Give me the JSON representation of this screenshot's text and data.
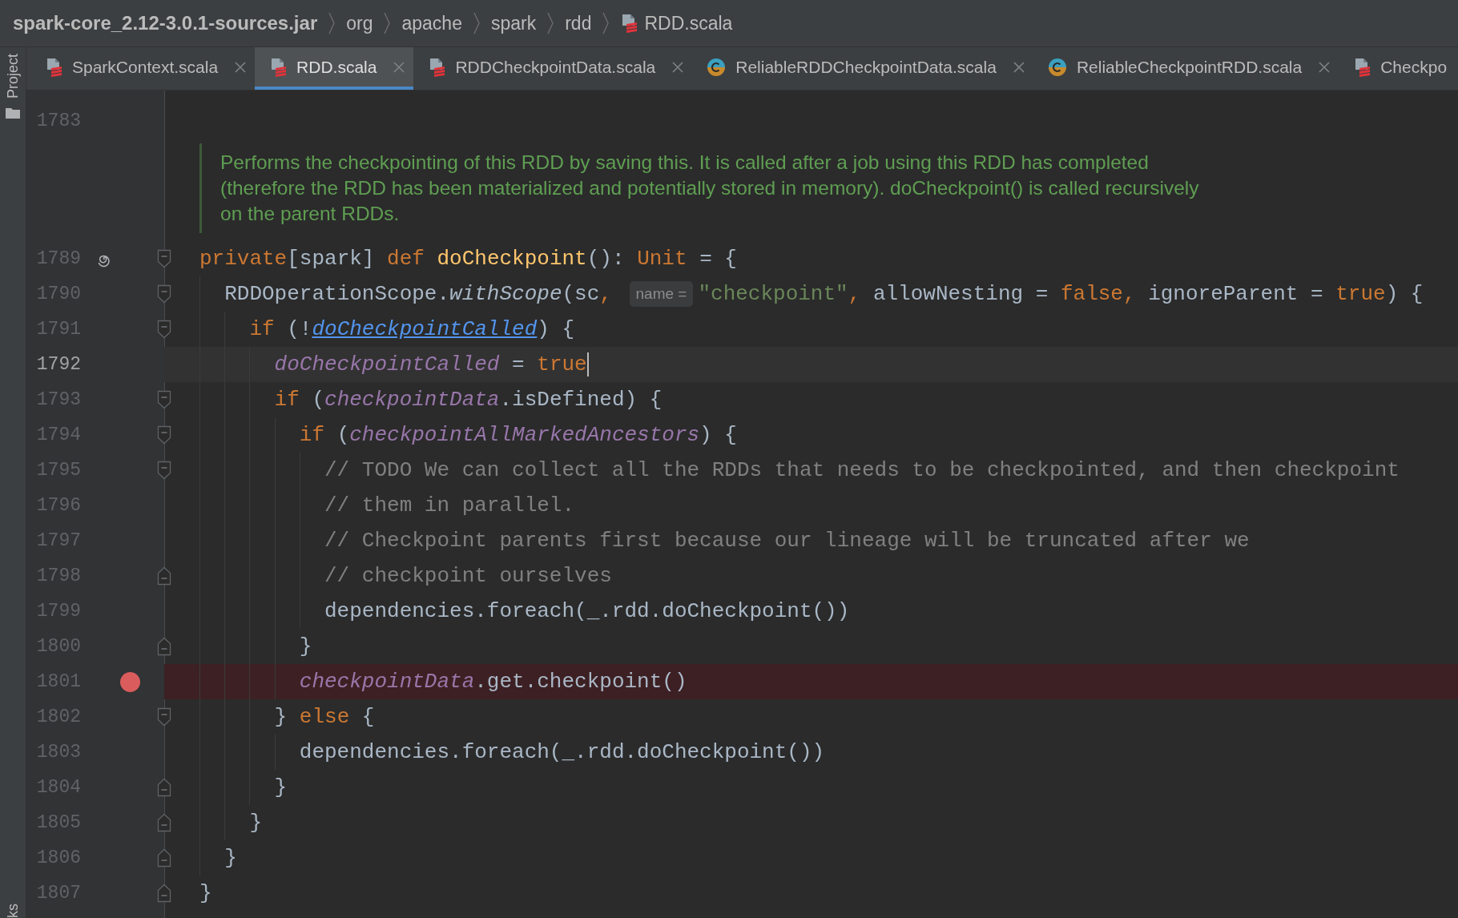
{
  "breadcrumbs": [
    {
      "label": "spark-core_2.12-3.0.1-sources.jar",
      "kind": "archive"
    },
    {
      "label": "org",
      "kind": "package"
    },
    {
      "label": "apache",
      "kind": "package"
    },
    {
      "label": "spark",
      "kind": "package"
    },
    {
      "label": "rdd",
      "kind": "package"
    },
    {
      "label": "RDD.scala",
      "kind": "scala_file"
    }
  ],
  "tool_strip": [
    {
      "label": "Project",
      "kind": "project"
    },
    {
      "label": "ks",
      "kind": "bookmarks"
    }
  ],
  "tabs": [
    {
      "label": "SparkContext.scala",
      "kind": "scala_file",
      "selected": false,
      "closable": true
    },
    {
      "label": "RDD.scala",
      "kind": "scala_file",
      "selected": true,
      "closable": true
    },
    {
      "label": "RDDCheckpointData.scala",
      "kind": "scala_file",
      "selected": false,
      "closable": true
    },
    {
      "label": "ReliableRDDCheckpointData.scala",
      "kind": "class",
      "selected": false,
      "closable": true
    },
    {
      "label": "ReliableCheckpointRDD.scala",
      "kind": "class",
      "selected": false,
      "closable": true
    },
    {
      "label": "Checkpo",
      "kind": "scala_file",
      "selected": false,
      "closable": false
    }
  ],
  "editor": {
    "lines": [
      {
        "kind": "code",
        "number": "1783",
        "recursion_marker": false,
        "breakpoint": false,
        "current": false,
        "caret": false
      },
      {
        "kind": "doc",
        "lines": [
          "Performs the checkpointing of this RDD by saving this. It is called after a job using this RDD has completed",
          "(therefore the RDD has been materialized and potentially stored in memory). doCheckpoint() is called recursively",
          "on the parent RDDs."
        ]
      },
      {
        "kind": "fold_start",
        "number": "1789",
        "recursion_marker": true,
        "breakpoint": false,
        "current": false,
        "caret": false,
        "tokens": [
          {
            "kind": "keyword",
            "text": "private"
          },
          {
            "kind": "plain",
            "text": "[spark] "
          },
          {
            "kind": "keyword",
            "text": "def "
          },
          {
            "kind": "declaration",
            "text": "doCheckpoint"
          },
          {
            "kind": "plain",
            "text": "(): "
          },
          {
            "kind": "keyword",
            "text": "Unit"
          },
          {
            "kind": "plain",
            "text": " = {"
          }
        ]
      },
      {
        "kind": "fold_start",
        "number": "1790",
        "recursion_marker": false,
        "breakpoint": false,
        "current": false,
        "caret": false,
        "tokens": [
          {
            "kind": "plain",
            "text": "  RDDOperationScope."
          },
          {
            "kind": "call",
            "text": "withScope"
          },
          {
            "kind": "plain",
            "text": "(sc"
          },
          {
            "kind": "keyword",
            "text": ", "
          },
          {
            "kind": "hint",
            "text": "name ="
          },
          {
            "kind": "string",
            "text": "\"checkpoint\""
          },
          {
            "kind": "keyword",
            "text": ", "
          },
          {
            "kind": "plain",
            "text": "allowNesting = "
          },
          {
            "kind": "keyword",
            "text": "false, "
          },
          {
            "kind": "plain",
            "text": "ignoreParent = "
          },
          {
            "kind": "keyword",
            "text": "true"
          },
          {
            "kind": "plain",
            "text": ") {"
          }
        ]
      },
      {
        "kind": "fold_start",
        "number": "1791",
        "recursion_marker": false,
        "breakpoint": false,
        "current": false,
        "caret": false,
        "tokens": [
          {
            "kind": "keyword",
            "text": "    if "
          },
          {
            "kind": "plain",
            "text": "(!"
          },
          {
            "kind": "link",
            "text": "doCheckpointCalled"
          },
          {
            "kind": "plain",
            "text": ") {"
          }
        ]
      },
      {
        "kind": "code",
        "number": "1792",
        "recursion_marker": false,
        "breakpoint": false,
        "current": true,
        "caret": true,
        "tokens": [
          {
            "kind": "field",
            "text": "      doCheckpointCalled"
          },
          {
            "kind": "plain",
            "text": " = "
          },
          {
            "kind": "keyword",
            "text": "true"
          }
        ]
      },
      {
        "kind": "fold_start",
        "number": "1793",
        "recursion_marker": false,
        "breakpoint": false,
        "current": false,
        "caret": false,
        "tokens": [
          {
            "kind": "keyword",
            "text": "      if "
          },
          {
            "kind": "plain",
            "text": "("
          },
          {
            "kind": "field",
            "text": "checkpointData"
          },
          {
            "kind": "plain",
            "text": ".isDefined) {"
          }
        ]
      },
      {
        "kind": "fold_start",
        "number": "1794",
        "recursion_marker": false,
        "breakpoint": false,
        "current": false,
        "caret": false,
        "tokens": [
          {
            "kind": "keyword",
            "text": "        if "
          },
          {
            "kind": "plain",
            "text": "("
          },
          {
            "kind": "field",
            "text": "checkpointAllMarkedAncestors"
          },
          {
            "kind": "plain",
            "text": ") {"
          }
        ]
      },
      {
        "kind": "fold_start",
        "number": "1795",
        "recursion_marker": false,
        "breakpoint": false,
        "current": false,
        "caret": false,
        "tokens": [
          {
            "kind": "comment",
            "text": "          // TODO We can collect all the RDDs that needs to be checkpointed, and then checkpoint"
          }
        ]
      },
      {
        "kind": "code",
        "number": "1796",
        "recursion_marker": false,
        "breakpoint": false,
        "current": false,
        "caret": false,
        "tokens": [
          {
            "kind": "comment",
            "text": "          // them in parallel."
          }
        ]
      },
      {
        "kind": "code",
        "number": "1797",
        "recursion_marker": false,
        "breakpoint": false,
        "current": false,
        "caret": false,
        "tokens": [
          {
            "kind": "comment",
            "text": "          // Checkpoint parents first because our lineage will be truncated after we"
          }
        ]
      },
      {
        "kind": "fold_end",
        "number": "1798",
        "recursion_marker": false,
        "breakpoint": false,
        "current": false,
        "caret": false,
        "tokens": [
          {
            "kind": "comment",
            "text": "          // checkpoint ourselves"
          }
        ]
      },
      {
        "kind": "code",
        "number": "1799",
        "recursion_marker": false,
        "breakpoint": false,
        "current": false,
        "caret": false,
        "tokens": [
          {
            "kind": "plain",
            "text": "          dependencies.foreach(_.rdd.doCheckpoint())"
          }
        ]
      },
      {
        "kind": "fold_end",
        "number": "1800",
        "recursion_marker": false,
        "breakpoint": false,
        "current": false,
        "caret": false,
        "tokens": [
          {
            "kind": "plain",
            "text": "        }"
          }
        ]
      },
      {
        "kind": "code",
        "number": "1801",
        "recursion_marker": false,
        "breakpoint": true,
        "current": false,
        "caret": false,
        "tokens": [
          {
            "kind": "field",
            "text": "        checkpointData"
          },
          {
            "kind": "plain",
            "text": ".get.checkpoint()"
          }
        ]
      },
      {
        "kind": "fold_start",
        "number": "1802",
        "recursion_marker": false,
        "breakpoint": false,
        "current": false,
        "caret": false,
        "tokens": [
          {
            "kind": "plain",
            "text": "      } "
          },
          {
            "kind": "keyword",
            "text": "else"
          },
          {
            "kind": "plain",
            "text": " {"
          }
        ]
      },
      {
        "kind": "code",
        "number": "1803",
        "recursion_marker": false,
        "breakpoint": false,
        "current": false,
        "caret": false,
        "tokens": [
          {
            "kind": "plain",
            "text": "        dependencies.foreach(_.rdd.doCheckpoint())"
          }
        ]
      },
      {
        "kind": "fold_end",
        "number": "1804",
        "recursion_marker": false,
        "breakpoint": false,
        "current": false,
        "caret": false,
        "tokens": [
          {
            "kind": "plain",
            "text": "      }"
          }
        ]
      },
      {
        "kind": "fold_end",
        "number": "1805",
        "recursion_marker": false,
        "breakpoint": false,
        "current": false,
        "caret": false,
        "tokens": [
          {
            "kind": "plain",
            "text": "    }"
          }
        ]
      },
      {
        "kind": "fold_end",
        "number": "1806",
        "recursion_marker": false,
        "breakpoint": false,
        "current": false,
        "caret": false,
        "tokens": [
          {
            "kind": "plain",
            "text": "  }"
          }
        ]
      },
      {
        "kind": "fold_end",
        "number": "1807",
        "recursion_marker": false,
        "breakpoint": false,
        "current": false,
        "caret": false,
        "tokens": [
          {
            "kind": "plain",
            "text": "}"
          }
        ]
      }
    ]
  }
}
